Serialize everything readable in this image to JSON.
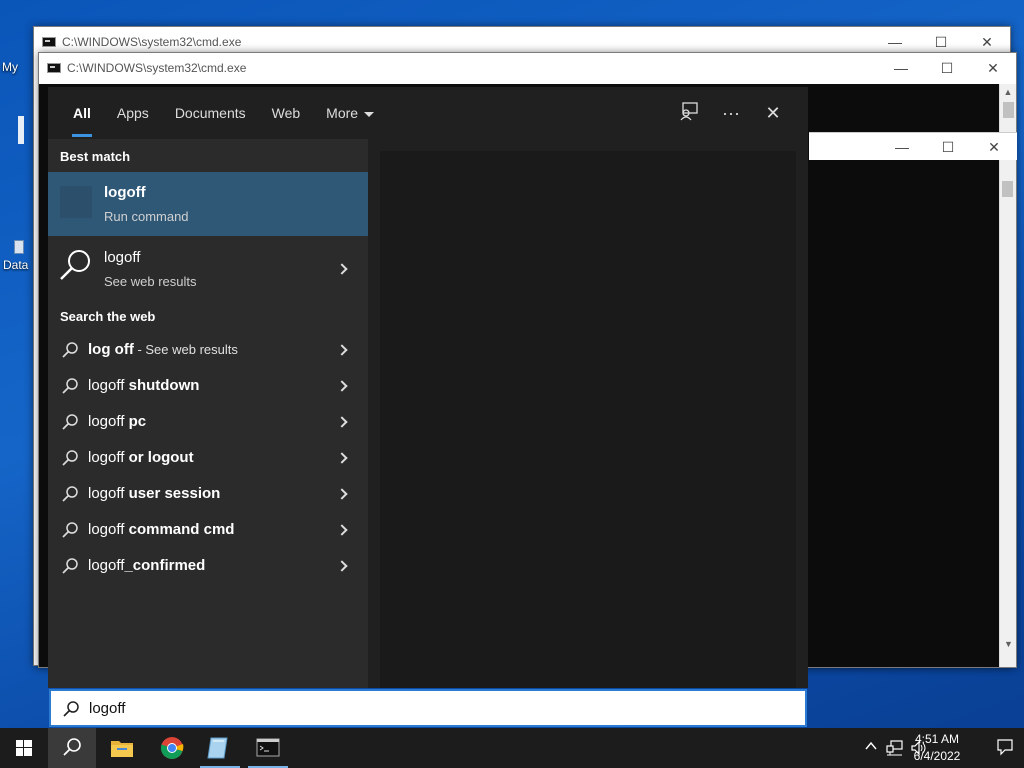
{
  "desktop": {
    "icon_labels": [
      "My",
      "Data"
    ]
  },
  "cmd_windows": [
    {
      "title": "C:\\WINDOWS\\system32\\cmd.exe"
    },
    {
      "title": "C:\\WINDOWS\\system32\\cmd.exe"
    }
  ],
  "window_controls": {
    "minimize": "—",
    "maximize": "☐",
    "close": "✕"
  },
  "search": {
    "tabs": [
      "All",
      "Apps",
      "Documents",
      "Web",
      "More"
    ],
    "active_tab": "All",
    "top_icons": {
      "feedback": "feedback-icon",
      "more": "···",
      "close": "✕"
    },
    "best_match_header": "Best match",
    "best_match": {
      "title": "logoff",
      "subtitle": "Run command"
    },
    "web_result": {
      "title": "logoff",
      "subtitle": "See web results"
    },
    "search_web_header": "Search the web",
    "suggestions": [
      {
        "prefix": "",
        "bold": "log off",
        "suffix": " - See web results"
      },
      {
        "prefix": "logoff",
        "bold": " shutdown",
        "suffix": ""
      },
      {
        "prefix": "logoff",
        "bold": " pc",
        "suffix": ""
      },
      {
        "prefix": "logoff",
        "bold": " or logout",
        "suffix": ""
      },
      {
        "prefix": "logoff",
        "bold": " user session",
        "suffix": ""
      },
      {
        "prefix": "logoff",
        "bold": " command cmd",
        "suffix": ""
      },
      {
        "prefix": "logoff",
        "bold": "_confirmed",
        "suffix": ""
      }
    ],
    "query": "logoff"
  },
  "taskbar": {
    "pinned": [
      "start-button",
      "search-button",
      "file-explorer",
      "chrome",
      "notepad-app",
      "cmd-app"
    ],
    "clock_time": "4:51 AM",
    "clock_date": "6/4/2022"
  },
  "colors": {
    "accent": "#3c93e0",
    "best_match_bg": "#2f5877",
    "panel_bg": "#202020"
  }
}
